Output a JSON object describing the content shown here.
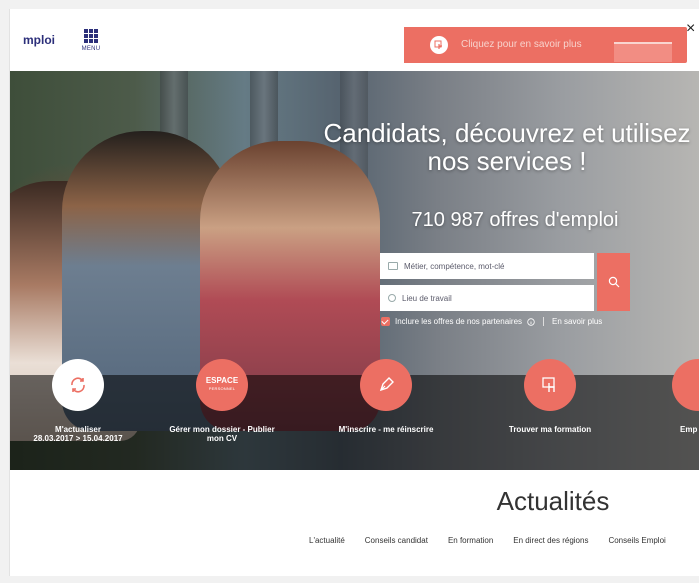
{
  "header": {
    "logo_text": "mploi",
    "menu_label": "MENU",
    "promo_text": "Cliquez pour en savoir plus",
    "close_symbol": "×"
  },
  "hero": {
    "title": "Candidats, découvrez et utilisez nos services !",
    "offers": "710 987 offres d'emploi",
    "search": {
      "job_placeholder": "Métier, compétence, mot-clé",
      "location_placeholder": "Lieu de travail",
      "partners_label": "Inclure les offres de nos partenaires",
      "more_link": "En savoir plus"
    },
    "services": [
      {
        "label": "M'actualiser",
        "sublabel": "28.03.2017 > 15.04.2017"
      },
      {
        "label": "Gérer mon dossier - Publier mon CV",
        "badge_main": "ESPACE",
        "badge_sub": "PERSONNEL"
      },
      {
        "label": "M'inscrire - me réinscrire"
      },
      {
        "label": "Trouver ma formation"
      },
      {
        "label": "Emp"
      }
    ]
  },
  "news": {
    "title": "Actualités",
    "tabs": [
      "L'actualité",
      "Conseils candidat",
      "En formation",
      "En direct des régions",
      "Conseils Emploi"
    ]
  },
  "colors": {
    "accent": "#ec6f63",
    "brand": "#2c2f7a"
  }
}
